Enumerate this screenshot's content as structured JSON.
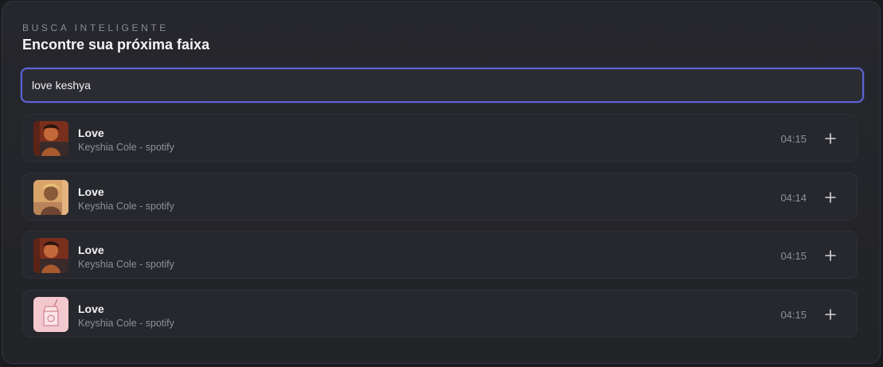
{
  "header": {
    "eyebrow": "BUSCA INTELIGENTE",
    "title": "Encontre sua próxima faixa"
  },
  "search": {
    "value": "love keshya"
  },
  "results": [
    {
      "title": "Love",
      "meta": "Keyshia Cole - spotify",
      "duration": "04:15",
      "cover": "red-portrait"
    },
    {
      "title": "Love",
      "meta": "Keyshia Cole - spotify",
      "duration": "04:14",
      "cover": "gold-portrait"
    },
    {
      "title": "Love",
      "meta": "Keyshia Cole - spotify",
      "duration": "04:15",
      "cover": "red-portrait"
    },
    {
      "title": "Love",
      "meta": "Keyshia Cole - spotify",
      "duration": "04:15",
      "cover": "pink-juice-box"
    }
  ],
  "colors": {
    "accent": "#5b63d3",
    "background": "#1a1b1f"
  }
}
